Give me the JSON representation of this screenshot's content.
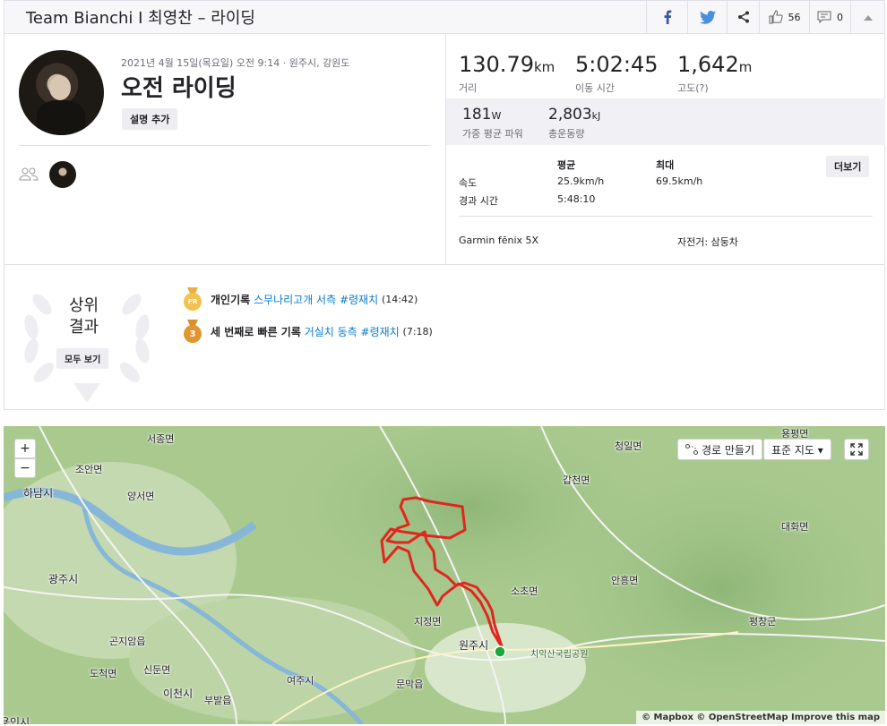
{
  "header": {
    "title": "Team Bianchi I 최영찬 – 라이딩",
    "kudos_count": "56",
    "comment_count": "0"
  },
  "activity": {
    "date": "2021년 4월 15일(목요일) 오전 9:14 · 원주시, 강원도",
    "title": "오전 라이딩",
    "add_description": "설명 추가"
  },
  "stats": {
    "distance": {
      "value": "130.79",
      "unit": "km",
      "label": "거리"
    },
    "moving_time": {
      "value": "5:02:45",
      "label": "이동 시간"
    },
    "elevation": {
      "value": "1,642",
      "unit": "m",
      "label": "고도(?)"
    },
    "power": {
      "value": "181",
      "unit": "W",
      "label": "가중 평균 파워"
    },
    "energy": {
      "value": "2,803",
      "unit": "kJ",
      "label": "총운동량"
    }
  },
  "table": {
    "col_avg": "평균",
    "col_max": "최대",
    "more": "더보기",
    "speed_label": "속도",
    "speed_avg": "25.9km/h",
    "speed_max": "69.5km/h",
    "elapsed_label": "경과 시간",
    "elapsed_avg": "5:48:10"
  },
  "device": "Garmin fēnix 5X",
  "bike": "자전거: 삼둥차",
  "results": {
    "title_line1": "상위",
    "title_line2": "결과",
    "view_all": "모두 보기",
    "items": [
      {
        "prefix": "개인기록",
        "segment": "스무나리고개 서측 #령재치",
        "time": "(14:42)",
        "medal": "PR"
      },
      {
        "prefix": "세 번째로 빠른 기록",
        "segment": "거실치 동측 #령재치",
        "time": "(7:18)",
        "medal": "3"
      }
    ]
  },
  "map": {
    "zoom_in": "+",
    "zoom_out": "−",
    "route_builder": "경로 만들기",
    "map_type": "표준 지도 ▾",
    "attribution": "© Mapbox © OpenStreetMap Improve this map",
    "places": [
      "서종면",
      "청일면",
      "용평면",
      "조안면",
      "하남시",
      "양서면",
      "갑천면",
      "대화면",
      "광주시",
      "소초면",
      "안흥면",
      "지정면",
      "평창군",
      "곤지암읍",
      "원주시",
      "치악산국립공원",
      "도척면",
      "신둔면",
      "여주시",
      "이천시",
      "부발읍",
      "문막읍",
      "용인시"
    ]
  }
}
